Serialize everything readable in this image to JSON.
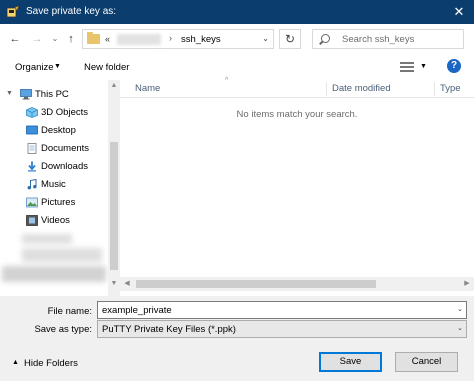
{
  "window": {
    "title": "Save private key as:"
  },
  "address": {
    "prefix": "«",
    "current": "ssh_keys"
  },
  "search": {
    "placeholder": "Search ssh_keys"
  },
  "toolbar": {
    "organize_label": "Organize",
    "new_folder_label": "New folder",
    "help_label": "?"
  },
  "nav": {
    "this_pc": "This PC",
    "items": [
      {
        "label": "3D Objects",
        "icon": "3d-objects-icon"
      },
      {
        "label": "Desktop",
        "icon": "desktop-icon"
      },
      {
        "label": "Documents",
        "icon": "documents-icon"
      },
      {
        "label": "Downloads",
        "icon": "downloads-icon"
      },
      {
        "label": "Music",
        "icon": "music-icon"
      },
      {
        "label": "Pictures",
        "icon": "pictures-icon"
      },
      {
        "label": "Videos",
        "icon": "videos-icon"
      }
    ]
  },
  "list": {
    "columns": {
      "name": "Name",
      "date_modified": "Date modified",
      "type": "Type"
    },
    "empty_message": "No items match your search."
  },
  "form": {
    "file_name_label": "File name:",
    "file_name_value": "example_private",
    "save_as_type_label": "Save as type:",
    "save_as_type_value": "PuTTY Private Key Files (*.ppk)"
  },
  "footer": {
    "hide_folders_label": "Hide Folders",
    "save_label": "Save",
    "cancel_label": "Cancel"
  },
  "colors": {
    "titlebar": "#0b3d6e",
    "accent": "#0078d7",
    "header_text": "#4c607a"
  }
}
